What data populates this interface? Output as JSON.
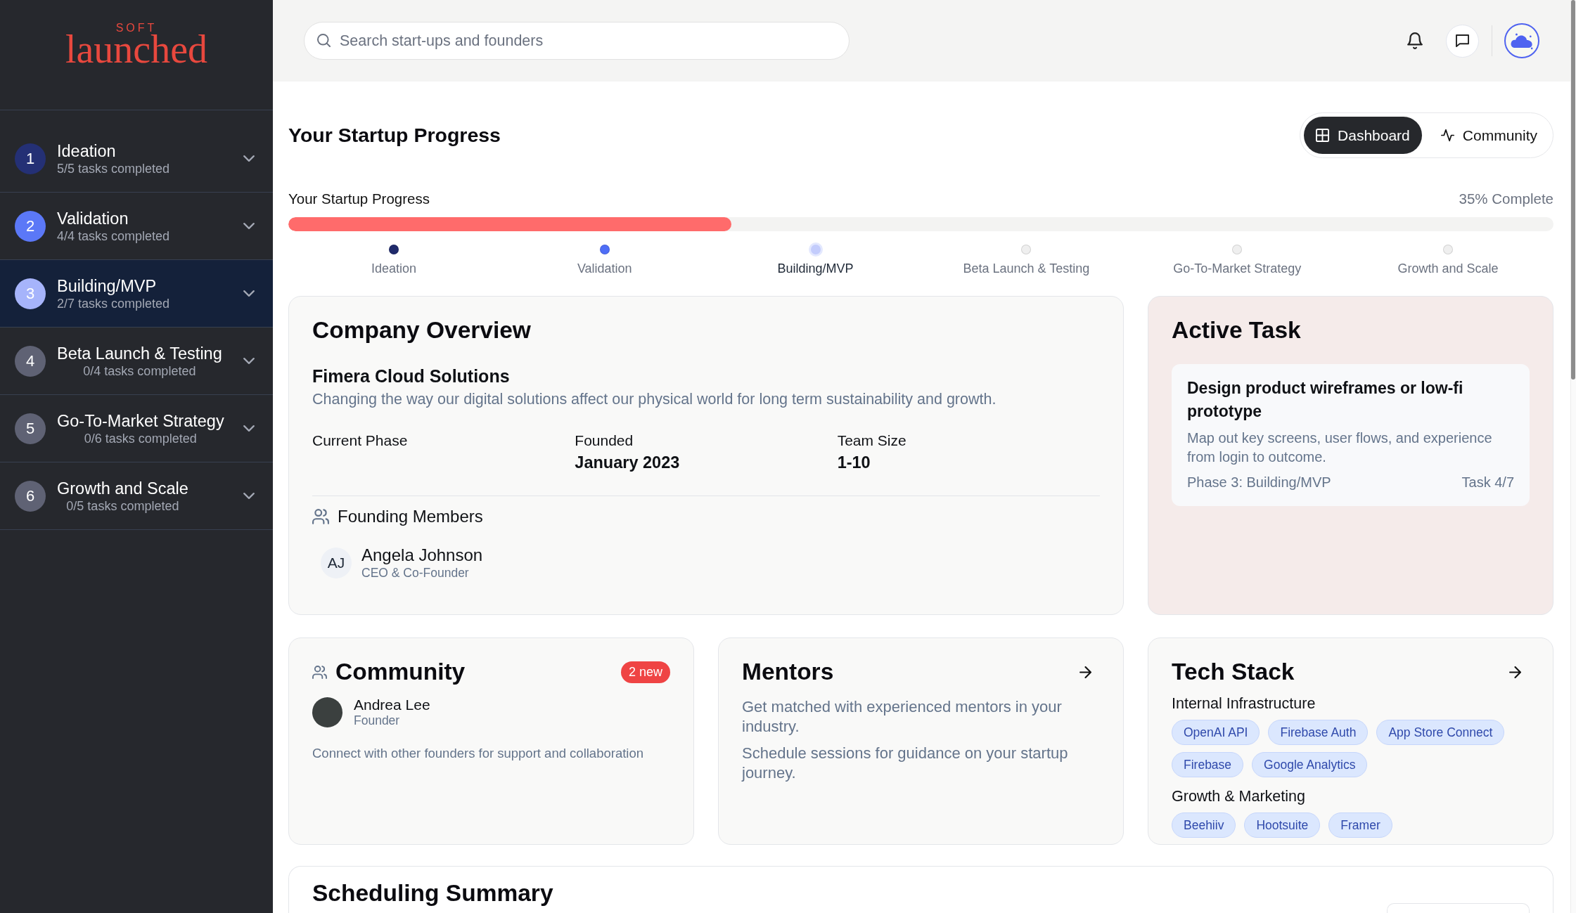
{
  "sidebar": {
    "logo": {
      "tagline": "SOFT",
      "wordmark": "launched"
    },
    "phases": [
      {
        "number": "1",
        "title": "Ideation",
        "progress": "5/5 tasks completed",
        "color": "#243075",
        "selected": false,
        "expanded": false
      },
      {
        "number": "2",
        "title": "Validation",
        "progress": "4/4 tasks completed",
        "color": "#5b78f7",
        "selected": false,
        "expanded": false
      },
      {
        "number": "3",
        "title": "Building/MVP",
        "progress": "2/7 tasks completed",
        "color": "#a6b4fb",
        "selected": true,
        "expanded": false
      },
      {
        "number": "4",
        "title": "Beta Launch & Testing",
        "progress": "0/4 tasks completed",
        "color": "#5f6274",
        "selected": false,
        "expanded": false
      },
      {
        "number": "5",
        "title": "Go-To-Market Strategy",
        "progress": "0/6 tasks completed",
        "color": "#5f6274",
        "selected": false,
        "expanded": false
      },
      {
        "number": "6",
        "title": "Growth and Scale",
        "progress": "0/5 tasks completed",
        "color": "#5f6274",
        "selected": false,
        "expanded": false
      }
    ]
  },
  "header": {
    "search": {
      "placeholder": "Search start-ups and founders"
    }
  },
  "page": {
    "title": "Your Startup Progress",
    "view_tabs": [
      {
        "label": "Dashboard",
        "selected": true
      },
      {
        "label": "Community",
        "selected": false
      }
    ]
  },
  "progress": {
    "label": "Your Startup Progress",
    "reading": "35% Complete",
    "level": 0.35,
    "steps": [
      {
        "label": "Ideation",
        "color": "#1f2a6b",
        "current": false
      },
      {
        "label": "Validation",
        "color": "#4f6ef7",
        "current": false
      },
      {
        "label": "Building/MVP",
        "color": "#c3ccfc",
        "current": true
      },
      {
        "label": "Beta Launch & Testing",
        "color": "#efefef",
        "current": false
      },
      {
        "label": "Go-To-Market Strategy",
        "color": "#efefef",
        "current": false
      },
      {
        "label": "Growth and Scale",
        "color": "#efefef",
        "current": false
      }
    ]
  },
  "company_overview": {
    "title": "Company Overview",
    "company": "Fimera Cloud Solutions",
    "description": "Changing the way our digital solutions affect our physical world for long term sustainability and growth.",
    "facts": [
      {
        "label": "Current Phase"
      },
      {
        "label": "Founded",
        "value": "January 2023"
      },
      {
        "label": "Team Size",
        "value": "1-10"
      }
    ],
    "members_heading": "Founding Members",
    "members": [
      {
        "initials": "AJ",
        "name": "Angela Johnson",
        "role": "CEO & Co-Founder"
      }
    ]
  },
  "active_task": {
    "title": "Active Task",
    "task": {
      "title": "Design product wireframes or low-fi prototype",
      "description": "Map out key screens, user flows, and experience from login to outcome.",
      "phase": "Phase 3: Building/MVP",
      "position": "Task 4/7"
    }
  },
  "community": {
    "title": "Community",
    "badge": "2 new",
    "members": [
      {
        "name": "Andrea Lee",
        "role": "Founder"
      }
    ],
    "description": "Connect with other founders for support and collaboration"
  },
  "mentors": {
    "title": "Mentors",
    "paragraphs": [
      "Get matched with experienced mentors in your industry.",
      "Schedule sessions for guidance on your startup journey."
    ]
  },
  "tech_stack": {
    "title": "Tech Stack",
    "groups": [
      {
        "name": "Internal Infrastructure",
        "tools": [
          "OpenAI API",
          "Firebase Auth",
          "App Store Connect",
          "Firebase",
          "Google Analytics"
        ]
      },
      {
        "name": "Growth & Marketing",
        "tools": [
          "Beehiiv",
          "Hootsuite",
          "Framer"
        ]
      }
    ]
  },
  "scheduling_summary": {
    "title": "Scheduling Summary"
  }
}
